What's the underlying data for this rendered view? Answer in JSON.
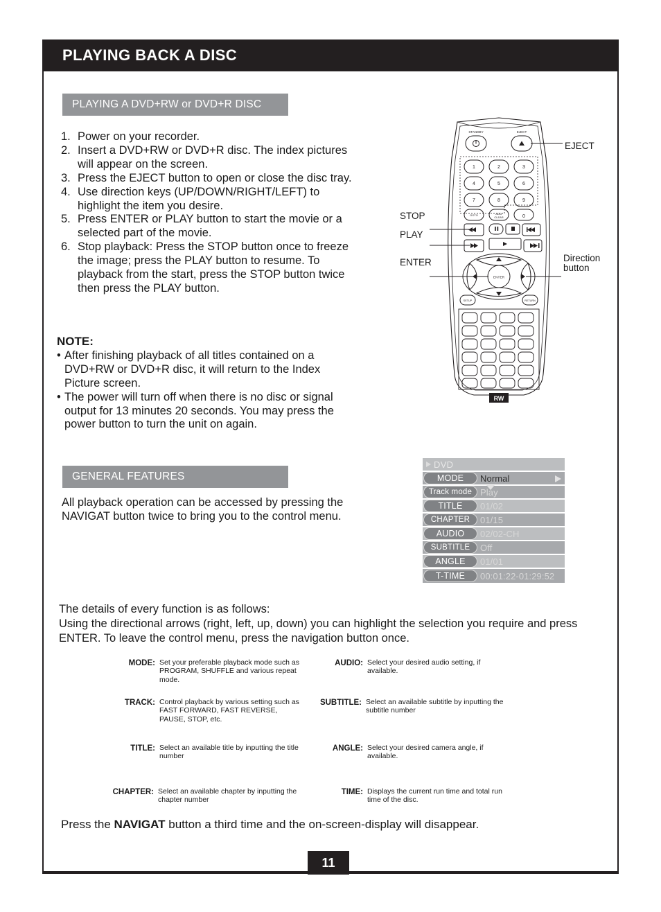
{
  "header": {
    "title": "PLAYING BACK A DISC"
  },
  "sections": {
    "dvdrw_head": "PLAYING A DVD+RW or DVD+R DISC",
    "general_head": "GENERAL FEATURES"
  },
  "steps": [
    {
      "num": "1.",
      "text": "Power on your recorder."
    },
    {
      "num": "2.",
      "text": "Insert a DVD+RW or DVD+R disc. The index pictures will appear on the screen."
    },
    {
      "num": "3.",
      "text": "Press the EJECT button to open or close the disc tray."
    },
    {
      "num": "4.",
      "text": "Use direction keys (UP/DOWN/RIGHT/LEFT) to highlight the item you desire."
    },
    {
      "num": "5.",
      "text": "Press ENTER or PLAY button to start the movie or a selected part of the movie."
    },
    {
      "num": "6.",
      "text": "Stop playback: Press the STOP button once to freeze the image; press the PLAY button to resume. To playback from the start, press the STOP button twice then press the PLAY button."
    }
  ],
  "note": {
    "title": "NOTE:",
    "items": [
      "After finishing playback of all titles contained on a DVD+RW or DVD+R disc, it will return to the Index Picture screen.",
      "The power will turn off when there is no disc or signal output for 13 minutes 20 seconds. You may press the power button to turn the unit on again."
    ],
    "bullet": "•"
  },
  "general_para": "All playback operation can be accessed by pressing the NAVIGAT button twice to bring you to the control menu.",
  "details_para": "The details of every function is as follows:\nUsing the directional arrows (right, left, up, down) you can highlight the selection you require and press ENTER. To leave the control menu, press the navigation button once.",
  "osd": {
    "header_label": "DVD",
    "rows": [
      {
        "label": "MODE",
        "value": "Normal"
      },
      {
        "label": "Track mode",
        "value": "Play"
      },
      {
        "label": "TITLE",
        "value": "01/02"
      },
      {
        "label": "CHAPTER",
        "value": "01/15"
      },
      {
        "label": "AUDIO",
        "value": "02/02-CH"
      },
      {
        "label": "SUBTITLE",
        "value": "Off"
      },
      {
        "label": "ANGLE",
        "value": "01/01"
      },
      {
        "label": "T-TIME",
        "value": "00:01:22-01:29:52"
      }
    ]
  },
  "remote_callouts": {
    "eject": "EJECT",
    "stop": "STOP",
    "play": "PLAY",
    "enter": "ENTER",
    "direction": "Direction\nbutton"
  },
  "remote_keys": {
    "standby": "STANDBY",
    "eject": "EJECT",
    "enter": "ENTER",
    "digits": [
      "1",
      "2",
      "3",
      "4",
      "5",
      "6",
      "7",
      "8",
      "9",
      "0"
    ]
  },
  "definitions": [
    {
      "left": {
        "term": "MODE:",
        "desc": "Set your preferable playback mode such as PROGRAM, SHUFFLE and various repeat mode."
      },
      "right": {
        "term": "AUDIO:",
        "desc": "Select your desired audio setting, if available."
      }
    },
    {
      "left": {
        "term": "TRACK:",
        "desc": "Control playback by various setting such as  FAST FORWARD, FAST REVERSE, PAUSE, STOP, etc."
      },
      "right": {
        "term": "SUBTITLE:",
        "desc": "Select an available subtitle by inputting the subtitle number"
      }
    },
    {
      "left": {
        "term": "TITLE:",
        "desc": "Select an available title by inputting the title number"
      },
      "right": {
        "term": "ANGLE:",
        "desc": "Select your desired camera angle, if available."
      }
    },
    {
      "left": {
        "term": "CHAPTER:",
        "desc": "Select an available chapter by inputting the chapter number"
      },
      "right": {
        "term": "TIME:",
        "desc": "Displays the current run time and total run time of the disc."
      }
    }
  ],
  "final_line": {
    "prefix": "Press the ",
    "bold": "NAVIGAT",
    "suffix": " button a third time and the on-screen-display will disappear."
  },
  "footer": {
    "page_number": "11"
  },
  "colors": {
    "title_bar": "#231f20",
    "section_head": "#939598",
    "osd_row": "#a7a9ac",
    "osd_row_light": "#bcbec0",
    "osd_pill": "#808285"
  }
}
